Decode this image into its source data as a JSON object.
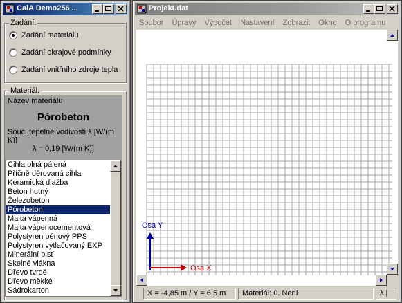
{
  "left_window": {
    "title": "CalA Demo256 ...",
    "zadani": {
      "legend": "Zadání:",
      "options": [
        {
          "label": "Zadání materiálu",
          "checked": true
        },
        {
          "label": "Zadání okrajové podmínky",
          "checked": false
        },
        {
          "label": "Zadání vnitřního zdroje tepla",
          "checked": false
        }
      ]
    },
    "material": {
      "legend": "Materiál:",
      "name_label": "Název materiálu",
      "name_value": "Pórobeton",
      "conductivity_label": "Souč. tepelné vodivosti λ [W/(m K)]",
      "conductivity_value": "λ = 0,19 [W/(m K)]"
    },
    "materials_list": [
      "Cihla plná pálená",
      "Příčně děrovaná cihla",
      "Keramická dlažba",
      "Beton hutný",
      "Železobeton",
      "Pórobeton",
      "Malta vápenná",
      "Malta vápenocementová",
      "Polystyren pěnový PPS",
      "Polystyren vytlačovaný EXP",
      "Minerální plsť",
      "Skelné vlákna",
      "Dřevo tvrdé",
      "Dřevo měkké",
      "Sádrokarton"
    ],
    "selected_material": "Pórobeton"
  },
  "right_window": {
    "title": "Projekt.dat",
    "menu": [
      "Soubor",
      "Úpravy",
      "Výpočet",
      "Nastavení",
      "Zobrazit",
      "Okno",
      "O programu"
    ],
    "axis_x_label": "Osa X",
    "axis_y_label": "Osa Y",
    "axis_colors": {
      "x": "#cc0000",
      "y": "#0000aa"
    },
    "status": {
      "coords": "X = -4,85 m / Y = 6,5 m",
      "material": "Materiál: 0. Není",
      "lambda": "λ |"
    }
  },
  "colors": {
    "title_active": "#0a246a",
    "selection": "#0a246a",
    "material_panel": "#a0a0a0",
    "window_face": "#d4d0c8"
  }
}
